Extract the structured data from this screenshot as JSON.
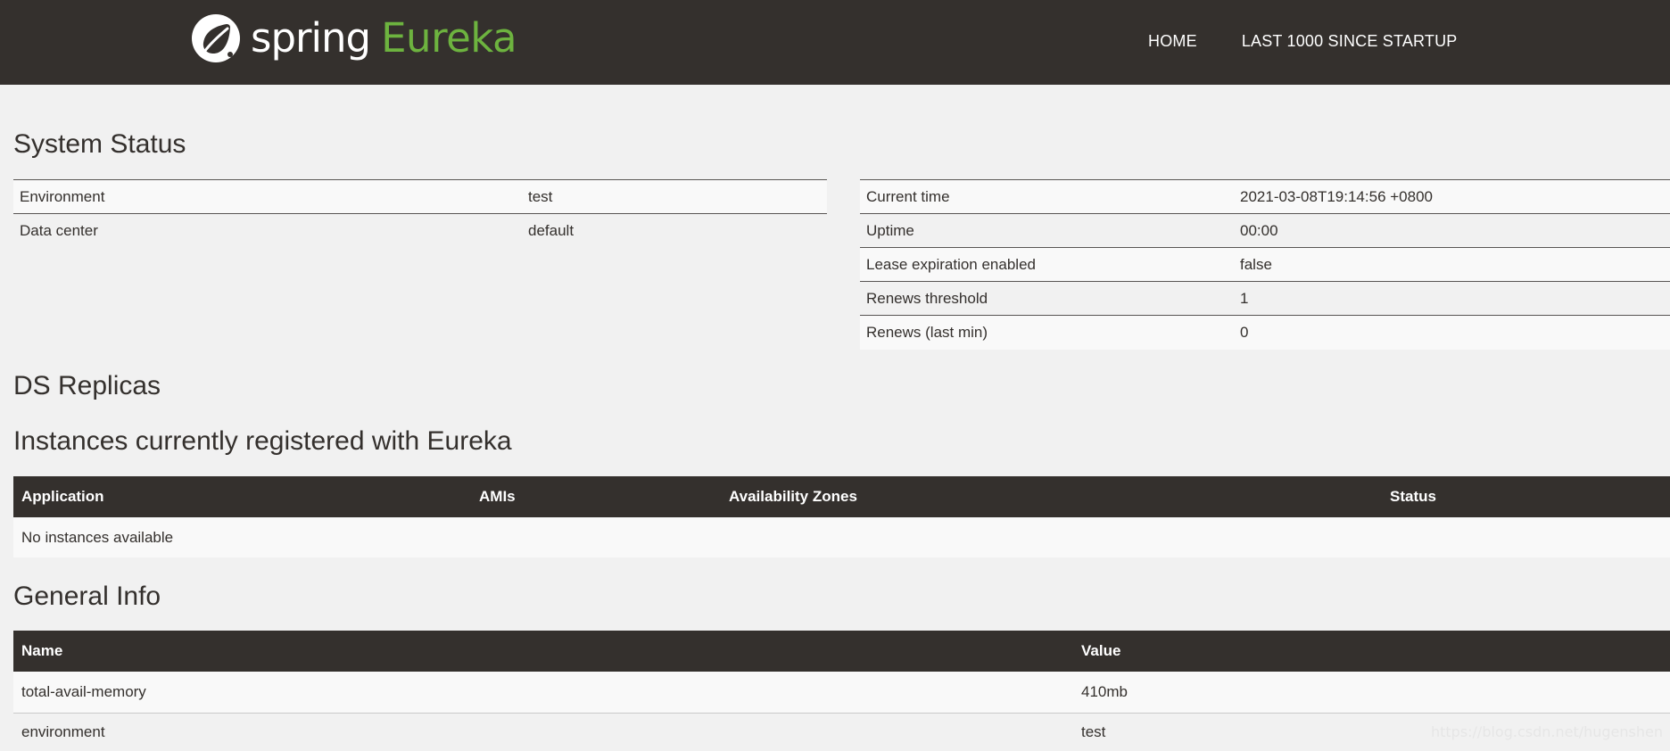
{
  "brand": {
    "spring": "spring",
    "eureka": "Eureka",
    "accent_color": "#6db33f",
    "header_color": "#34302d"
  },
  "nav": {
    "home": "HOME",
    "last1000": "LAST 1000 SINCE STARTUP"
  },
  "system_status": {
    "title": "System Status",
    "left": [
      {
        "label": "Environment",
        "value": "test"
      },
      {
        "label": "Data center",
        "value": "default"
      }
    ],
    "right": [
      {
        "label": "Current time",
        "value": "2021-03-08T19:14:56 +0800"
      },
      {
        "label": "Uptime",
        "value": "00:00"
      },
      {
        "label": "Lease expiration enabled",
        "value": "false"
      },
      {
        "label": "Renews threshold",
        "value": "1"
      },
      {
        "label": "Renews (last min)",
        "value": "0"
      }
    ]
  },
  "ds_replicas": {
    "title": "DS Replicas"
  },
  "instances": {
    "title": "Instances currently registered with Eureka",
    "headers": [
      "Application",
      "AMIs",
      "Availability Zones",
      "Status"
    ],
    "empty_message": "No instances available"
  },
  "general_info": {
    "title": "General Info",
    "headers": [
      "Name",
      "Value"
    ],
    "rows": [
      {
        "name": "total-avail-memory",
        "value": "410mb"
      },
      {
        "name": "environment",
        "value": "test"
      }
    ]
  },
  "watermark": "https://blog.csdn.net/hugenshen"
}
